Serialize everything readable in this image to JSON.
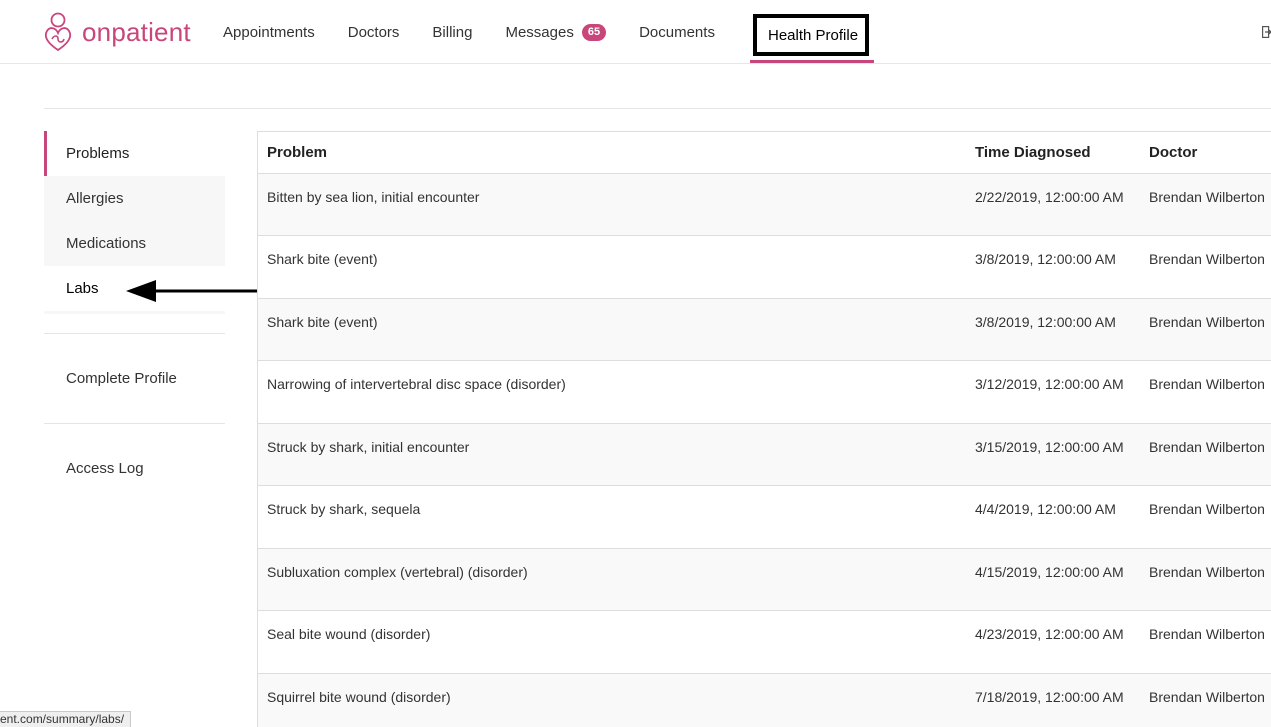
{
  "brand": {
    "name": "onpatient",
    "accent_color": "#c9467c"
  },
  "nav": {
    "items": [
      {
        "label": "Appointments"
      },
      {
        "label": "Doctors"
      },
      {
        "label": "Billing"
      },
      {
        "label": "Messages",
        "badge": "65"
      },
      {
        "label": "Documents"
      }
    ],
    "active": {
      "label": "Health Profile"
    },
    "right_icon": "logout-icon"
  },
  "sidebar": {
    "items": [
      {
        "label": "Problems",
        "active": true
      },
      {
        "label": "Allergies"
      },
      {
        "label": "Medications"
      },
      {
        "label": "Labs",
        "highlighted": true
      }
    ],
    "secondary": [
      {
        "label": "Complete Profile"
      },
      {
        "label": "Access Log"
      }
    ]
  },
  "table": {
    "columns": [
      "Problem",
      "Time Diagnosed",
      "Doctor"
    ],
    "rows": [
      {
        "problem": "Bitten by sea lion, initial encounter",
        "time": "2/22/2019, 12:00:00 AM",
        "doctor": "Brendan Wilberton"
      },
      {
        "problem": "Shark bite (event)",
        "time": "3/8/2019, 12:00:00 AM",
        "doctor": "Brendan Wilberton"
      },
      {
        "problem": "Shark bite (event)",
        "time": "3/8/2019, 12:00:00 AM",
        "doctor": "Brendan Wilberton"
      },
      {
        "problem": "Narrowing of intervertebral disc space (disorder)",
        "time": "3/12/2019, 12:00:00 AM",
        "doctor": "Brendan Wilberton"
      },
      {
        "problem": "Struck by shark, initial encounter",
        "time": "3/15/2019, 12:00:00 AM",
        "doctor": "Brendan Wilberton"
      },
      {
        "problem": "Struck by shark, sequela",
        "time": "4/4/2019, 12:00:00 AM",
        "doctor": "Brendan Wilberton"
      },
      {
        "problem": "Subluxation complex (vertebral) (disorder)",
        "time": "4/15/2019, 12:00:00 AM",
        "doctor": "Brendan Wilberton"
      },
      {
        "problem": "Seal bite wound (disorder)",
        "time": "4/23/2019, 12:00:00 AM",
        "doctor": "Brendan Wilberton"
      },
      {
        "problem": "Squirrel bite wound (disorder)",
        "time": "7/18/2019, 12:00:00 AM",
        "doctor": "Brendan Wilberton"
      }
    ]
  },
  "status_bar": {
    "url": "ent.com/summary/labs/"
  },
  "annotation": {
    "arrow_target": "Labs",
    "arrow_color": "#000000"
  }
}
